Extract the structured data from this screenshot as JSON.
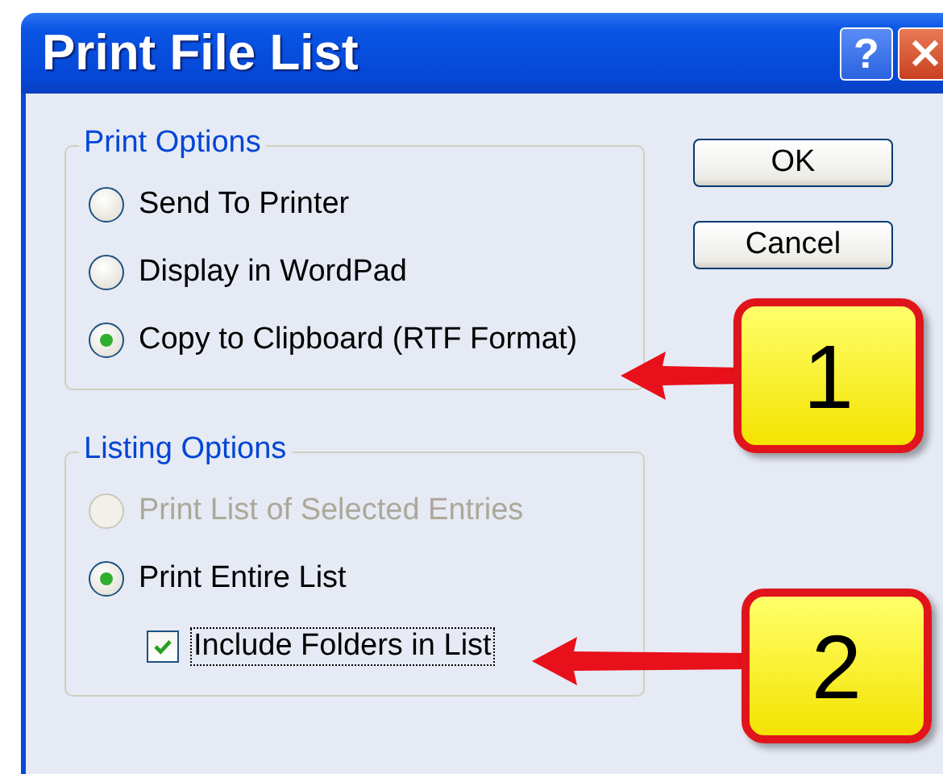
{
  "window": {
    "title": "Print File List",
    "help_button": "?"
  },
  "groups": [
    {
      "title": "Print Options",
      "options": [
        {
          "kind": "radio",
          "label": "Send To Printer",
          "selected": false,
          "disabled": false
        },
        {
          "kind": "radio",
          "label": "Display in WordPad",
          "selected": false,
          "disabled": false
        },
        {
          "kind": "radio",
          "label": "Copy to Clipboard (RTF Format)",
          "selected": true,
          "disabled": false
        }
      ]
    },
    {
      "title": "Listing Options",
      "options": [
        {
          "kind": "radio",
          "label": "Print List of Selected Entries",
          "selected": false,
          "disabled": true
        },
        {
          "kind": "radio",
          "label": "Print Entire List",
          "selected": true,
          "disabled": false,
          "children": [
            {
              "kind": "checkbox",
              "label": "Include Folders in List",
              "checked": true,
              "disabled": false,
              "focused": true
            }
          ]
        }
      ]
    }
  ],
  "buttons": [
    "OK",
    "Cancel"
  ],
  "callouts": [
    {
      "number": "1"
    },
    {
      "number": "2"
    }
  ]
}
